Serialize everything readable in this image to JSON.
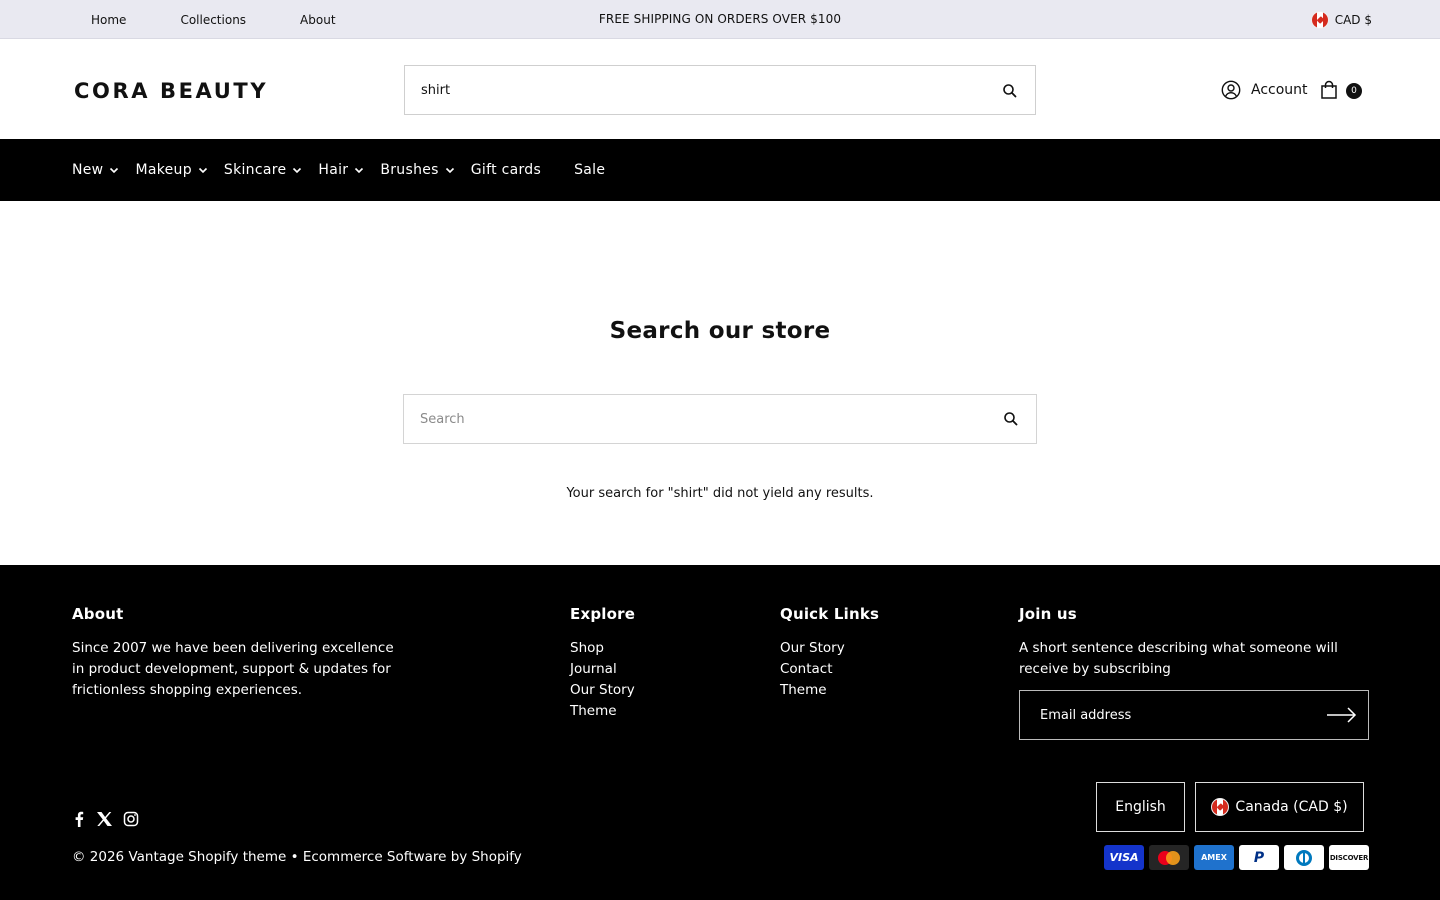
{
  "topbar": {
    "links": [
      "Home",
      "Collections",
      "About"
    ],
    "promo": "FREE SHIPPING ON ORDERS OVER $100",
    "currency": "CAD $"
  },
  "header": {
    "logo": "CORA BEAUTY",
    "search_value": "shirt",
    "account_label": "Account",
    "cart_count": "0"
  },
  "nav": {
    "items": [
      {
        "label": "New"
      },
      {
        "label": "Makeup"
      },
      {
        "label": "Skincare"
      },
      {
        "label": "Hair"
      },
      {
        "label": "Brushes"
      },
      {
        "label": "Gift cards"
      },
      {
        "label": "Sale"
      }
    ]
  },
  "main": {
    "title": "Search our store",
    "search_placeholder": "Search",
    "no_results": "Your search for \"shirt\" did not yield any results."
  },
  "footer": {
    "about": {
      "heading": "About",
      "text": "Since 2007 we have been delivering excellence in product development, support & updates for frictionless shopping experiences."
    },
    "explore": {
      "heading": "Explore",
      "items": [
        "Shop",
        "Journal",
        "Our Story",
        "Theme"
      ]
    },
    "quick_links": {
      "heading": "Quick Links",
      "items": [
        "Our Story",
        "Contact",
        "Theme"
      ]
    },
    "join": {
      "heading": "Join us",
      "text": "A short sentence describing what someone will receive by subscribing",
      "email_placeholder": "Email address"
    },
    "language": "English",
    "country": "Canada (CAD $)",
    "copyright": "© 2026 Vantage Shopify theme • Ecommerce Software by Shopify",
    "payments": [
      "VISA",
      "AMEX",
      "P",
      "DISCOVER"
    ]
  },
  "colors": {
    "topbar_bg": "#e9e9f1",
    "nav_bg": "#000000",
    "footer_bg": "#000000"
  }
}
